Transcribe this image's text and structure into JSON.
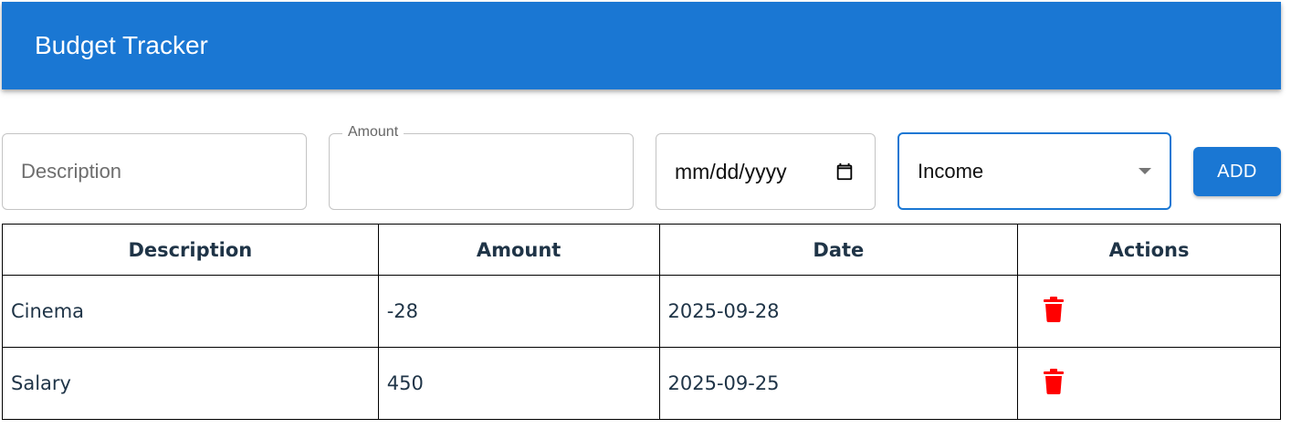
{
  "app_bar": {
    "title": "Budget Tracker",
    "color": "#1a77d3"
  },
  "form": {
    "description": {
      "placeholder": "Description",
      "value": ""
    },
    "amount": {
      "label": "Amount",
      "value": ""
    },
    "date": {
      "display": "mm/dd/yyyy",
      "icon": "calendar-icon"
    },
    "type_select": {
      "selected": "Income",
      "icon": "caret-down-icon"
    },
    "add_button": {
      "label": "ADD"
    }
  },
  "table": {
    "headers": [
      "Description",
      "Amount",
      "Date",
      "Actions"
    ],
    "rows": [
      {
        "description": "Cinema",
        "amount": "-28",
        "date": "2025-09-28",
        "action_icon": "trash-icon"
      },
      {
        "description": "Salary",
        "amount": "450",
        "date": "2025-09-25",
        "action_icon": "trash-icon"
      }
    ]
  },
  "colors": {
    "primary": "#1a77d3",
    "delete": "#ff0000",
    "text": "#1f3447"
  }
}
